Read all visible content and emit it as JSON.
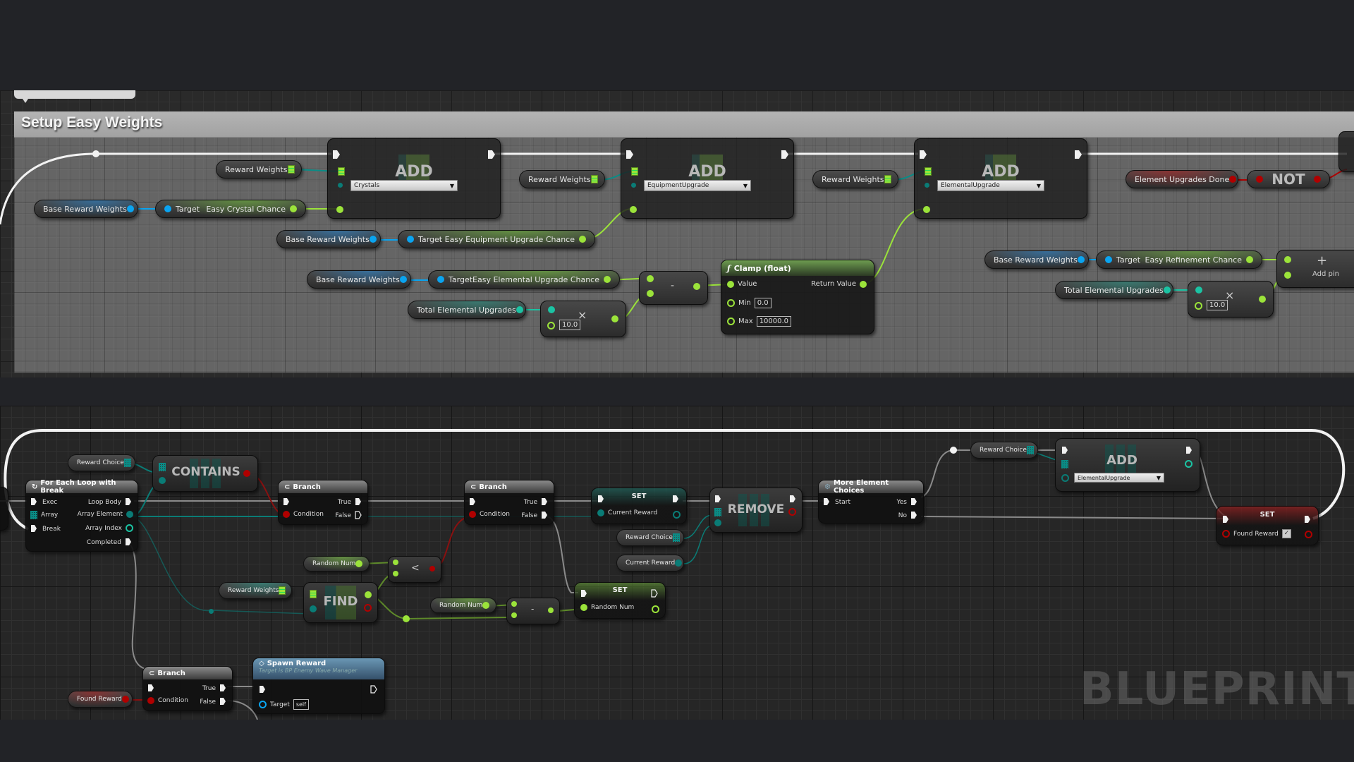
{
  "top_graph": {
    "comment_title": "Setup Easy Weights",
    "nodes": {
      "reward_weights_1": "Reward Weights",
      "reward_weights_2": "Reward Weights",
      "reward_weights_3": "Reward Weights",
      "base_reward_weights_1": "Base Reward Weights",
      "base_reward_weights_2": "Base Reward Weights",
      "base_reward_weights_3": "Base Reward Weights",
      "base_reward_weights_4": "Base Reward Weights",
      "get_crystal": {
        "target": "Target",
        "output": "Easy Crystal Chance"
      },
      "get_equipment": {
        "target": "Target",
        "output": "Easy Equipment Upgrade Chance"
      },
      "get_elemental": {
        "target": "Target",
        "output": "Easy Elemental Upgrade Chance"
      },
      "get_refinement": {
        "target": "Target",
        "output": "Easy Refinement Chance"
      },
      "total_elemental_1": "Total Elemental Upgrades",
      "total_elemental_2": "Total Elemental Upgrades",
      "add_1": {
        "label": "ADD",
        "dropdown": "Crystals"
      },
      "add_2": {
        "label": "ADD",
        "dropdown": "EquipmentUpgrade"
      },
      "add_3": {
        "label": "ADD",
        "dropdown": "ElementalUpgrade"
      },
      "multiply_1": {
        "symbol": "×",
        "value": "10.0"
      },
      "multiply_2": {
        "symbol": "×",
        "value": "10.0"
      },
      "subtract_1": {
        "symbol": "-"
      },
      "clamp": {
        "title": "Clamp (float)",
        "value_label": "Value",
        "return_label": "Return Value",
        "min_label": "Min",
        "min_value": "0.0",
        "max_label": "Max",
        "max_value": "10000.0"
      },
      "element_upgrades_done": "Element Upgrades Done",
      "not_node": "NOT",
      "add_pin": {
        "symbol": "+",
        "label": "Add pin"
      }
    }
  },
  "bottom_graph": {
    "nodes": {
      "reward_choice_1": "Reward Choice",
      "reward_choice_2": "Reward Choice",
      "reward_choice_3": "Reward Choice",
      "contains": "CONTAINS",
      "for_each": {
        "title": "For Each Loop with Break",
        "exec": "Exec",
        "array": "Array",
        "break": "Break",
        "loop_body": "Loop Body",
        "array_element": "Array Element",
        "array_index": "Array Index",
        "completed": "Completed"
      },
      "branch_1": {
        "title": "Branch",
        "condition": "Condition",
        "true": "True",
        "false": "False"
      },
      "branch_2": {
        "title": "Branch",
        "condition": "Condition",
        "true": "True",
        "false": "False"
      },
      "branch_3": {
        "title": "Branch",
        "condition": "Condition",
        "true": "True",
        "false": "False"
      },
      "set_current_reward": {
        "title": "SET",
        "pin": "Current Reward"
      },
      "current_reward_get": "Current Reward",
      "remove": "REMOVE",
      "more_element_choices": {
        "title": "More Element Choices",
        "start": "Start",
        "yes": "Yes",
        "no": "No"
      },
      "add_elemental": {
        "label": "ADD",
        "dropdown": "ElementalUpgrade"
      },
      "set_found_reward": {
        "title": "SET",
        "pin": "Found Reward",
        "checked": true
      },
      "random_num_1": "Random Num",
      "random_num_2": "Random Num",
      "less_than": "<",
      "reward_weights": "Reward Weights",
      "find": "FIND",
      "subtract": "-",
      "set_random_num": {
        "title": "SET",
        "pin": "Random Num"
      },
      "found_reward_get": "Found Reward",
      "spawn_reward": {
        "title": "Spawn Reward",
        "subtitle": "Target is BP Enemy Wave Manager",
        "target_label": "Target",
        "target_value": "self"
      }
    },
    "watermark": "BLUEPRINT"
  }
}
